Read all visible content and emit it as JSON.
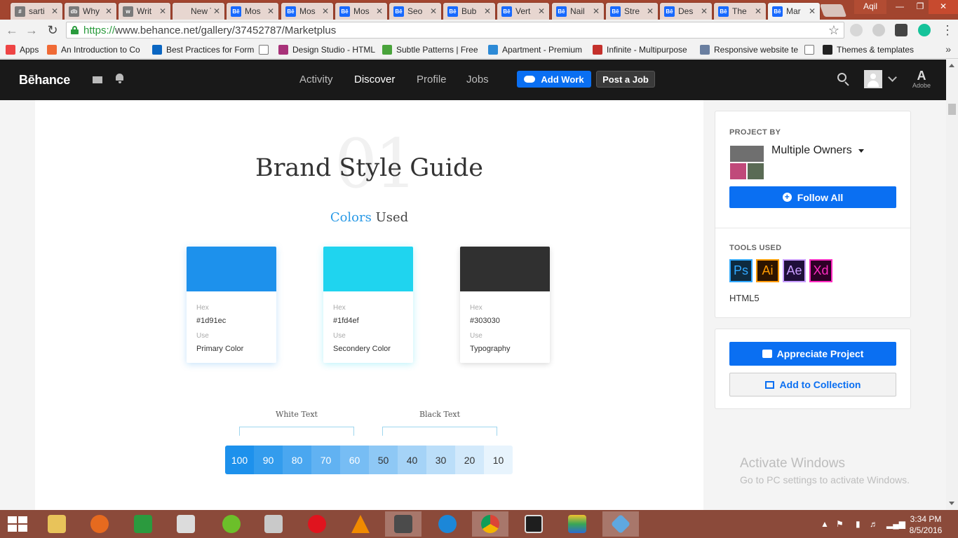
{
  "browser": {
    "tabs": [
      {
        "title": "sarti",
        "fav": "#"
      },
      {
        "title": "Why",
        "fav": "db"
      },
      {
        "title": "Writ",
        "fav": "w"
      },
      {
        "title": "New Ta",
        "fav": ""
      },
      {
        "title": "Mos",
        "fav": "Bē"
      },
      {
        "title": "Mos",
        "fav": "Bē"
      },
      {
        "title": "Mos",
        "fav": "Bē"
      },
      {
        "title": "Seo",
        "fav": "Bē"
      },
      {
        "title": "Bub",
        "fav": "Bē"
      },
      {
        "title": "Vert",
        "fav": "Bē"
      },
      {
        "title": "Nail",
        "fav": "Bē"
      },
      {
        "title": "Stre",
        "fav": "Bē"
      },
      {
        "title": "Des",
        "fav": "Bē"
      },
      {
        "title": "The",
        "fav": "Bē"
      },
      {
        "title": "Mar",
        "fav": "Bē",
        "active": true
      }
    ],
    "user": "Aqil",
    "url_scheme": "https://",
    "url_rest": "www.behance.net/gallery/37452787/Marketplus",
    "bookmarks": [
      {
        "label": "Apps",
        "icon": "apps-grid-icon",
        "color": "#e44"
      },
      {
        "label": "An Introduction to Co",
        "icon": "plus-square-icon",
        "color": "#f06a35"
      },
      {
        "label": "Best Practices for Form",
        "icon": "linkedin-icon",
        "color": "#0a66c2"
      },
      {
        "label": "",
        "icon": "page-icon",
        "color": "#ffffff"
      },
      {
        "label": "Design Studio - HTML",
        "icon": "d-icon",
        "color": "#a83279"
      },
      {
        "label": "Subtle Patterns | Free",
        "icon": "pattern-icon",
        "color": "#49a33b"
      },
      {
        "label": "Apartment - Premium",
        "icon": "house-icon",
        "color": "#2d8ad6"
      },
      {
        "label": "Infinite - Multipurpose",
        "icon": "wp-icon",
        "color": "#c4302b"
      },
      {
        "label": "Responsive website te",
        "icon": "shield-icon",
        "color": "#6a7fa0"
      },
      {
        "label": "",
        "icon": "page-icon",
        "color": "#ffffff"
      },
      {
        "label": "Themes & templates",
        "icon": "themeforest-icon",
        "color": "#222222"
      }
    ],
    "bookmarks_more": "»"
  },
  "behance": {
    "logo": "Bēhance",
    "nav": [
      {
        "label": "Activity",
        "active": false
      },
      {
        "label": "Discover",
        "active": true
      },
      {
        "label": "Profile",
        "active": false
      },
      {
        "label": "Jobs",
        "active": false
      }
    ],
    "add_work": "Add Work",
    "post_job": "Post a Job",
    "adobe_mark": "A",
    "adobe_label": "Adobe"
  },
  "project": {
    "number": "01",
    "title": "Brand Style Guide",
    "subtitle_accent": "Colors",
    "subtitle_rest": " Used",
    "swatches": [
      {
        "color": "#1d91ec",
        "hex_label": "Hex",
        "hex": "#1d91ec",
        "use_label": "Use",
        "use": "Primary Color"
      },
      {
        "color": "#1fd4ef",
        "hex_label": "Hex",
        "hex": "#1fd4ef",
        "use_label": "Use",
        "use": "Secondery Color"
      },
      {
        "color": "#303030",
        "hex_label": "Hex",
        "hex": "#303030",
        "use_label": "Use",
        "use": "Typography"
      }
    ],
    "white_text_label": "White Text",
    "black_text_label": "Black Text",
    "scale": [
      {
        "value": "100",
        "bg": "#1d91ec",
        "fg": "#ffffff"
      },
      {
        "value": "90",
        "bg": "#339ced",
        "fg": "#ffffff"
      },
      {
        "value": "80",
        "bg": "#4aa7f0",
        "fg": "#ffffff"
      },
      {
        "value": "70",
        "bg": "#61b2f2",
        "fg": "#ffffff"
      },
      {
        "value": "60",
        "bg": "#77bdf4",
        "fg": "#ffffff"
      },
      {
        "value": "50",
        "bg": "#8ec8f5",
        "fg": "#333333"
      },
      {
        "value": "40",
        "bg": "#a5d3f7",
        "fg": "#333333"
      },
      {
        "value": "30",
        "bg": "#bbdef9",
        "fg": "#333333"
      },
      {
        "value": "20",
        "bg": "#d2e9fb",
        "fg": "#333333"
      },
      {
        "value": "10",
        "bg": "#e8f4fd",
        "fg": "#333333"
      }
    ]
  },
  "sidebar": {
    "project_by_label": "PROJECT BY",
    "owner": "Multiple Owners",
    "follow_all": "Follow All",
    "tools_label": "TOOLS USED",
    "tools": [
      {
        "abbr": "Ps",
        "bg": "#0e2a3f",
        "fg": "#31a8ff",
        "name": "photoshop-icon"
      },
      {
        "abbr": "Ai",
        "bg": "#2d1400",
        "fg": "#ff9a00",
        "name": "illustrator-icon"
      },
      {
        "abbr": "Ae",
        "bg": "#1f0f3a",
        "fg": "#c79cff",
        "name": "after-effects-icon"
      },
      {
        "abbr": "Xd",
        "bg": "#2e0026",
        "fg": "#ff2bc2",
        "name": "xd-icon"
      }
    ],
    "extra_tool": "HTML5",
    "appreciate": "Appreciate Project",
    "add_collection": "Add to Collection"
  },
  "watermark": {
    "line1": "Activate Windows",
    "line2": "Go to PC settings to activate Windows."
  },
  "taskbar": {
    "time": "3:34 PM",
    "date": "8/5/2016"
  }
}
